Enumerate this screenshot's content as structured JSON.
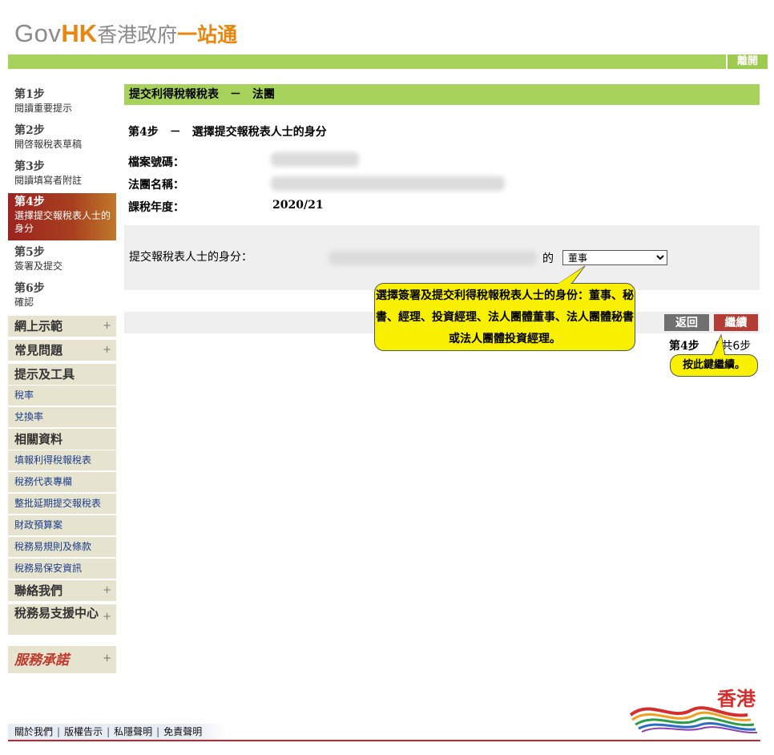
{
  "header": {
    "logo_gov": "Gov",
    "logo_hk": "HK",
    "logo_zh1": "香港政府",
    "logo_zh2": "一站通",
    "logout_label": "離開"
  },
  "steps": [
    {
      "num": "第1步",
      "desc": "閱讀重要提示"
    },
    {
      "num": "第2步",
      "desc": "開啓報稅表草稿"
    },
    {
      "num": "第3步",
      "desc": "閱讀填寫者附註"
    },
    {
      "num": "第4步",
      "desc": "選擇提交報稅表人士的身分"
    },
    {
      "num": "第5步",
      "desc": "簽署及提交"
    },
    {
      "num": "第6步",
      "desc": "確認"
    }
  ],
  "sidebar": {
    "demo": "網上示範",
    "faq": "常見問題",
    "tools_heading": "提示及工具",
    "tax_rate": "稅率",
    "exchange_rate": "兌換率",
    "related_heading": "相關資料",
    "related": [
      "填報利得稅報稅表",
      "稅務代表專欄",
      "整批延期提交報稅表",
      "財政預算案",
      "稅務易規則及條款",
      "稅務易保安資訊"
    ],
    "contact": "聯絡我們",
    "support": "稅務易支援中心",
    "pledge": "服務承諾",
    "plus": "+"
  },
  "main": {
    "title": "提交利得稅報稅表　－　法團",
    "step_heading": "第4步　－　選擇提交報稅表人士的身分",
    "file_no_label": "檔案號碼：",
    "corp_name_label": "法團名稱：",
    "year_label": "課稅年度：",
    "year_value": "2020/21",
    "identity_label": "提交報稅表人士的身分：",
    "identity_of": "的",
    "identity_selected": "董事",
    "back_label": "返回",
    "continue_label": "繼續",
    "step_current": "第4步",
    "step_sep": "/",
    "step_total": "共6步",
    "tip_identity": "選擇簽署及提交利得稅報稅表人士的身份：董事、秘書、經理、投資經理、法人團體董事、法人團體秘書或法人團體投資經理。",
    "tip_continue": "按此鍵繼續。"
  },
  "footer": {
    "links": [
      "關於我們",
      "版權告示",
      "私隱聲明",
      "免責聲明"
    ],
    "sep": "|",
    "brand": "香港"
  },
  "colors": {
    "green_bar": "#a7d25c",
    "active_step": "#a8401f",
    "tooltip": "#f8f000",
    "continue_btn": "#b33d35",
    "footer_line": "#c2272d"
  }
}
